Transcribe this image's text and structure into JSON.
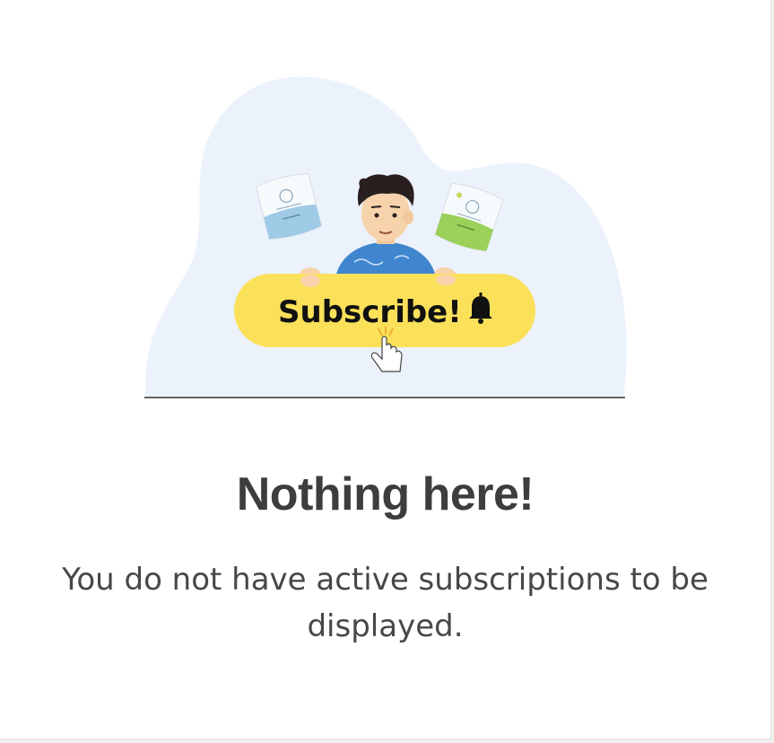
{
  "illustration": {
    "button_label": "Subscribe!",
    "bell_icon": "bell-icon",
    "cursor_icon": "hand-pointer-icon",
    "button_color": "#fbe05a",
    "blob_color": "#ecf2fb",
    "shirt_color": "#3f86cf"
  },
  "empty_state": {
    "title": "Nothing here!",
    "message": "You do not have active subscriptions to be displayed."
  }
}
